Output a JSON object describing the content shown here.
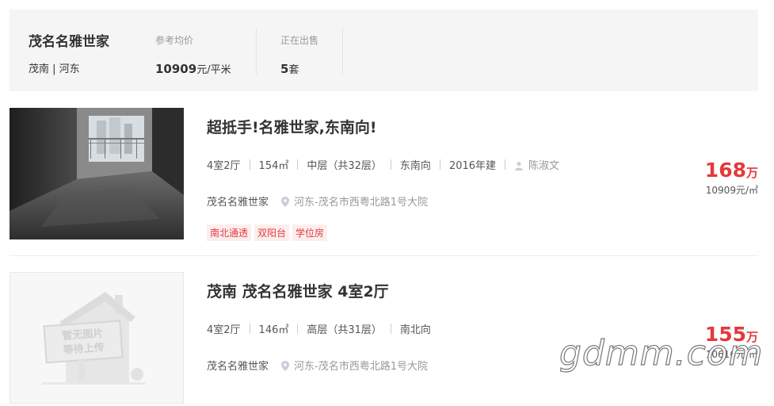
{
  "header": {
    "name": "茂名名雅世家",
    "area": "茂南 | 河东",
    "avg_price_label": "参考均价",
    "avg_price_value": "10909",
    "avg_price_unit": "元/平米",
    "on_sale_label": "正在出售",
    "on_sale_value": "5",
    "on_sale_unit": "套"
  },
  "listings": [
    {
      "title": "超抵手!名雅世家,东南向!",
      "layout": "4室2厅",
      "size": "154㎡",
      "floor": "中层（共32层）",
      "orientation": "东南向",
      "year": "2016年建",
      "agent": "陈淑文",
      "community": "茂名名雅世家",
      "address": "河东-茂名市西粤北路1号大院",
      "tags": [
        "南北通透",
        "双阳台",
        "学位房"
      ],
      "price": "168",
      "price_unit": "万",
      "unit_price": "10909元/㎡"
    },
    {
      "title": "茂南 茂名名雅世家 4室2厅",
      "layout": "4室2厅",
      "size": "146㎡",
      "floor": "高层（共31层）",
      "orientation": "南北向",
      "community": "茂名名雅世家",
      "address": "河东-茂名市西粤北路1号大院",
      "price": "155",
      "price_unit": "万",
      "unit_price": "10616元/㎡",
      "placeholder_line1": "暂无图片",
      "placeholder_line2": "等待上传"
    }
  ],
  "watermark": "gdmm.com",
  "colors": {
    "accent": "#e4393c",
    "header_bg": "#f5f5f5"
  }
}
